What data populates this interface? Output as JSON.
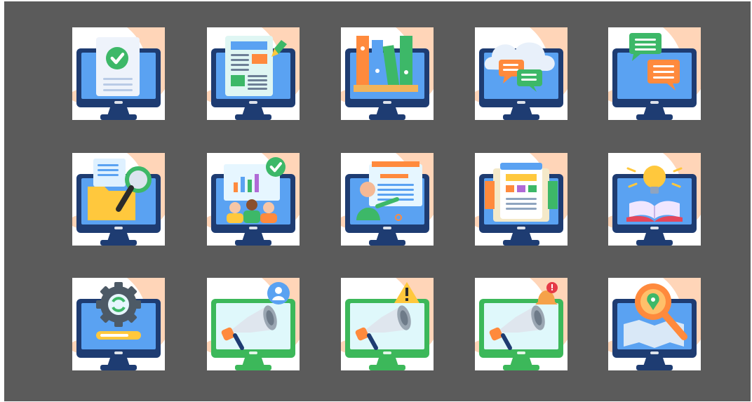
{
  "background_color": "#5b5b5b",
  "tile_color": "#ffffff",
  "palette": {
    "skin": "#ffd5b8",
    "hand_shadow": "#f5b995",
    "monitor_frame": "#1e3c72",
    "monitor_screen": "#5aa2f2",
    "monitor_stand": "#1e3c72",
    "green_frame": "#3cb85a",
    "green_screen": "#dff8fb",
    "orange": "#ff8a3d",
    "green": "#3db868",
    "yellow": "#ffc83d"
  },
  "icons": [
    {
      "name": "document-check-icon",
      "monitor": "blue"
    },
    {
      "name": "newspaper-edit-icon",
      "monitor": "blue"
    },
    {
      "name": "bookshelf-icon",
      "monitor": "blue"
    },
    {
      "name": "cloud-chat-icon",
      "monitor": "blue"
    },
    {
      "name": "chat-messages-icon",
      "monitor": "blue"
    },
    {
      "name": "folder-search-icon",
      "monitor": "blue"
    },
    {
      "name": "online-meeting-check-icon",
      "monitor": "blue"
    },
    {
      "name": "online-teacher-icon",
      "monitor": "blue"
    },
    {
      "name": "web-layout-icon",
      "monitor": "blue"
    },
    {
      "name": "online-learning-idea-icon",
      "monitor": "blue"
    },
    {
      "name": "settings-update-icon",
      "monitor": "blue"
    },
    {
      "name": "megaphone-user-icon",
      "monitor": "green"
    },
    {
      "name": "megaphone-warning-icon",
      "monitor": "green"
    },
    {
      "name": "megaphone-notification-icon",
      "monitor": "green"
    },
    {
      "name": "map-search-icon",
      "monitor": "blue"
    }
  ]
}
